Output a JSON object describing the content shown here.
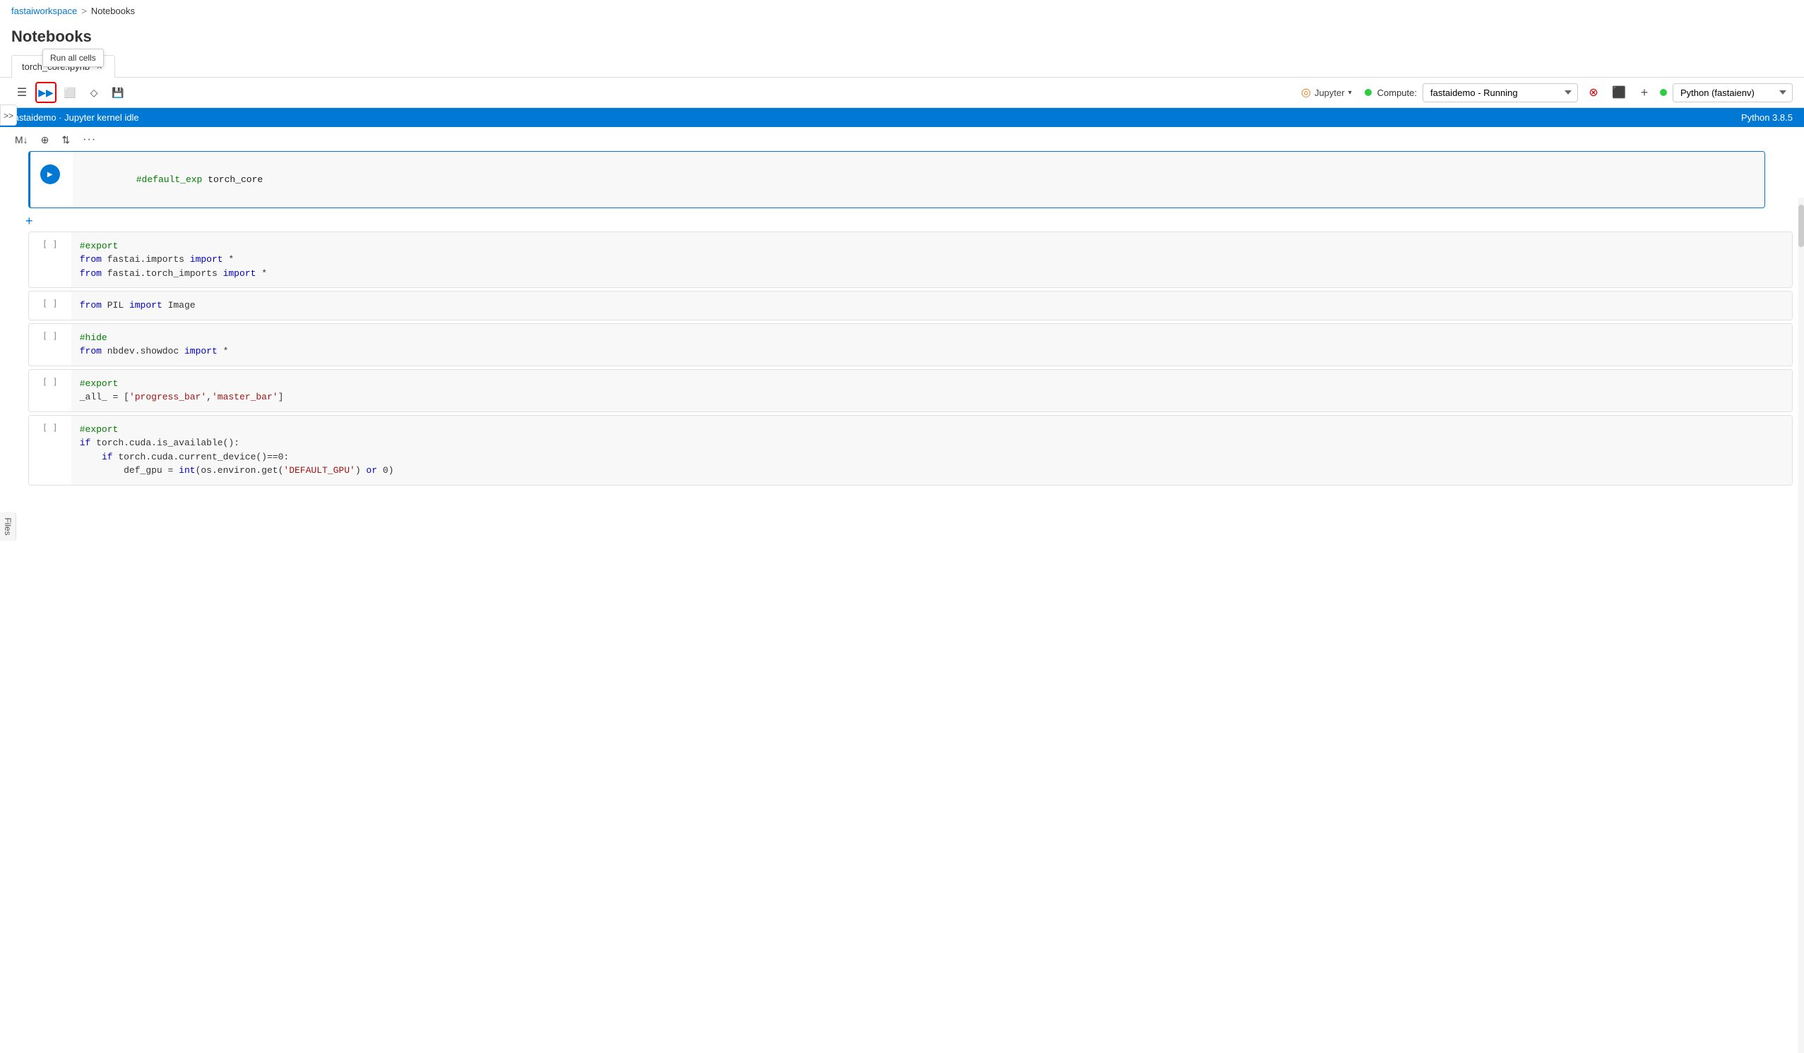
{
  "breadcrumb": {
    "workspace": "fastaiworkspace",
    "separator": ">",
    "current": "Notebooks"
  },
  "page": {
    "title": "Notebooks"
  },
  "tabs": [
    {
      "label": "torch_core.ipynb",
      "active": true,
      "closable": true
    }
  ],
  "tooltip": {
    "run_all": "Run all cells"
  },
  "toolbar": {
    "hamburger": "☰",
    "run_all": "▶▶",
    "stop": "□",
    "clear": "◇",
    "save": "💾",
    "jupyter_label": "Jupyter",
    "compute_label": "Compute:",
    "compute_value": "fastaidemo  -  Running",
    "kernel_value": "Python (fastaienv)",
    "python_version": "Python 3.8.5"
  },
  "status_bar": {
    "left": "fastaidemo · Jupyter kernel idle",
    "right": "Python 3.8.5"
  },
  "cell_toolbar": {
    "markdown": "M↓",
    "add_above": "⊞",
    "move": "⇅",
    "more": "···"
  },
  "files_label": "Files",
  "cells": [
    {
      "id": "cell-1",
      "active": true,
      "gutter": "",
      "runnable": true,
      "code": "#default_exp torch_core",
      "code_html": "<span class='cm'>#default_exp</span><span class='nm'> torch_core</span>"
    },
    {
      "id": "cell-2",
      "active": false,
      "gutter": "[ ]",
      "runnable": false,
      "code": "#export\nfrom fastai.imports import *\nfrom fastai.torch_imports import *",
      "code_html": "<span class='cm'>#export</span>\n<span class='kw'>from</span> fastai.imports <span class='kw'>import</span> *\n<span class='kw'>from</span> fastai.torch_imports <span class='kw'>import</span> *"
    },
    {
      "id": "cell-3",
      "active": false,
      "gutter": "[ ]",
      "runnable": false,
      "code": "from PIL import Image",
      "code_html": "<span class='kw'>from</span> PIL <span class='kw'>import</span> Image"
    },
    {
      "id": "cell-4",
      "active": false,
      "gutter": "[ ]",
      "runnable": false,
      "code": "#hide\nfrom nbdev.showdoc import *",
      "code_html": "<span class='cm'>#hide</span>\n<span class='kw'>from</span> nbdev.showdoc <span class='kw'>import</span> *"
    },
    {
      "id": "cell-5",
      "active": false,
      "gutter": "[ ]",
      "runnable": false,
      "code": "#export\n_all_ = ['progress_bar','master_bar']",
      "code_html": "<span class='cm'>#export</span>\n_all_ = [<span class='st'>'progress_bar'</span>,<span class='st'>'master_bar'</span>]"
    },
    {
      "id": "cell-6",
      "active": false,
      "gutter": "[ ]",
      "runnable": false,
      "code": "#export\nif torch.cuda.is_available():\n    if torch.cuda.current_device()==0:\n        def_gpu = int(os.environ.get('DEFAULT_GPU') or 0)",
      "code_html": "<span class='cm'>#export</span>\n<span class='kw'>if</span> torch.cuda.is_available():\n    <span class='kw'>if</span> torch.cuda.current_device()==0:\n        def_gpu = <span class='fn'>int</span>(os.environ.get(<span class='st'>'DEFAULT_GPU'</span>) <span class='kw'>or</span> 0)"
    }
  ]
}
